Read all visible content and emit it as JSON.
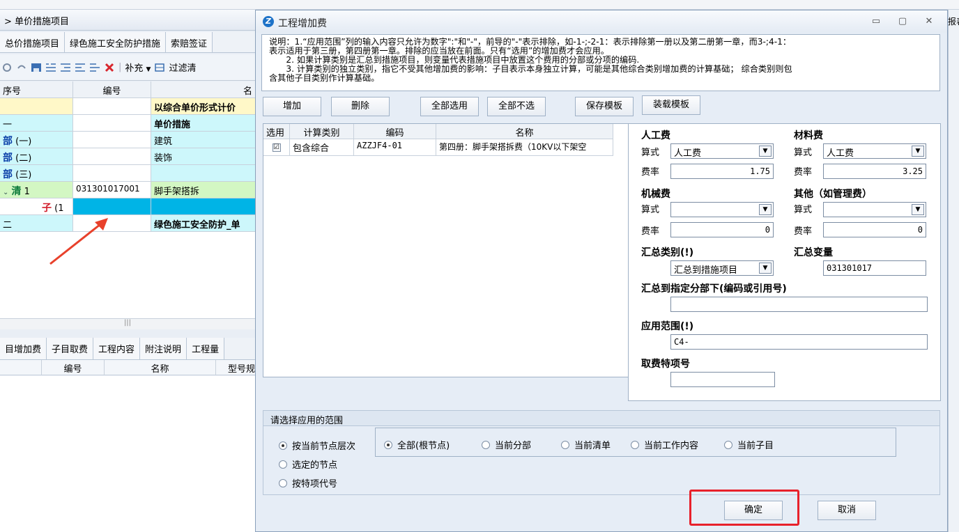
{
  "background_app": {
    "panel_title": "单价措施项目",
    "tabs": [
      "总价措施项目",
      "绿色施工安全防护措施",
      "索赔签证"
    ],
    "toolbar": {
      "supplement": "补充",
      "filter": "过滤清"
    },
    "grid": {
      "headers": [
        "序号",
        "编号",
        "名"
      ],
      "rows": [
        {
          "seq": "",
          "code": "",
          "name": "以综合单价形式计价"
        },
        {
          "seq": "一",
          "code": "",
          "name": "单价措施"
        },
        {
          "kw": "部",
          "seq": "(一)",
          "code": "",
          "name": "建筑"
        },
        {
          "kw": "部",
          "seq": "(二)",
          "code": "",
          "name": "装饰"
        },
        {
          "kw": "部",
          "seq": "(三)",
          "code": "",
          "name": ""
        },
        {
          "kw": "清",
          "seq": "1",
          "code": "031301017001",
          "name": "脚手架搭拆"
        },
        {
          "kw": "子",
          "seq": "(1",
          "code": "",
          "name": ""
        },
        {
          "seq": "二",
          "code": "",
          "name": "绿色施工安全防护_单"
        }
      ]
    },
    "bottom_tabs": [
      "目增加费",
      "子目取费",
      "工程内容",
      "附注说明",
      "工程量"
    ],
    "bottom_headers": [
      "编号",
      "名称",
      "型号规"
    ],
    "right_edge_label": "报表"
  },
  "dialog": {
    "title": "工程增加费",
    "description": [
      "说明：1.“应用范围”列的输入内容只允许为数字\":\"和\"-\"，前导的\"-\"表示排除，如-1-;-2-1：表示排除第一册以及第二册第一章，而3-;4-1：",
      "表示适用于第三册，第四册第一章。排除的应当放在前面。只有“选用”的增加费才会应用。",
      "　　2. 如果计算类别是汇总到措施项目，则变量代表措施项目中放置这个费用的分部或分项的编码.",
      "　　3. 计算类别的独立类别，指它不受其他增加费的影响：子目表示本身独立计算，可能是其他综合类别增加费的计算基础； 综合类别则包",
      "含其他子目类别作计算基础。"
    ],
    "buttons": {
      "add": "增加",
      "delete": "删除",
      "select_all": "全部选用",
      "deselect_all": "全部不选",
      "save_template": "保存模板",
      "load_template": "装载模板"
    },
    "table": {
      "headers": [
        "选用",
        "计算类别",
        "编码",
        "名称"
      ],
      "rows": [
        {
          "checked": "☑",
          "category": "包含综合",
          "code": "AZZJF4-01",
          "name": "第四册：脚手架搭拆费（10KV以下架空"
        }
      ]
    },
    "form": {
      "labor": {
        "title": "人工费",
        "formula_label": "算式",
        "formula": "人工费",
        "rate_label": "费率",
        "rate": "1.75"
      },
      "material": {
        "title": "材料费",
        "formula_label": "算式",
        "formula": "人工费",
        "rate_label": "费率",
        "rate": "3.25"
      },
      "machine": {
        "title": "机械费",
        "formula_label": "算式",
        "formula": "",
        "rate_label": "费率",
        "rate": "0"
      },
      "other": {
        "title": "其他（如管理费）",
        "formula_label": "算式",
        "formula": "",
        "rate_label": "费率",
        "rate": "0"
      },
      "summary_category": {
        "title": "汇总类别(!)",
        "value": "汇总到措施项目"
      },
      "summary_variable": {
        "title": "汇总变量",
        "value": "031301017"
      },
      "summary_to_section": {
        "title": "汇总到指定分部下(编码或引用号)",
        "value": ""
      },
      "apply_scope": {
        "title": "应用范围(!)",
        "value": "C4-"
      },
      "fee_item_code": {
        "title": "取费特项号",
        "value": ""
      }
    },
    "scope": {
      "legend": "请选择应用的范围",
      "left_options": [
        {
          "label": "按当前节点层次",
          "selected": true
        },
        {
          "label": "选定的节点",
          "selected": false
        },
        {
          "label": "按特项代号",
          "selected": false
        }
      ],
      "node_options": [
        {
          "label": "全部(根节点)",
          "selected": true
        },
        {
          "label": "当前分部",
          "selected": false
        },
        {
          "label": "当前清单",
          "selected": false
        },
        {
          "label": "当前工作内容",
          "selected": false
        },
        {
          "label": "当前子目",
          "selected": false
        }
      ]
    },
    "ok_label": "确定",
    "cancel_label": "取消"
  },
  "colors": {
    "accent_row": "#00b4e6",
    "highlight_box": "#e8212b",
    "annotation_arrow": "#e8412b"
  }
}
